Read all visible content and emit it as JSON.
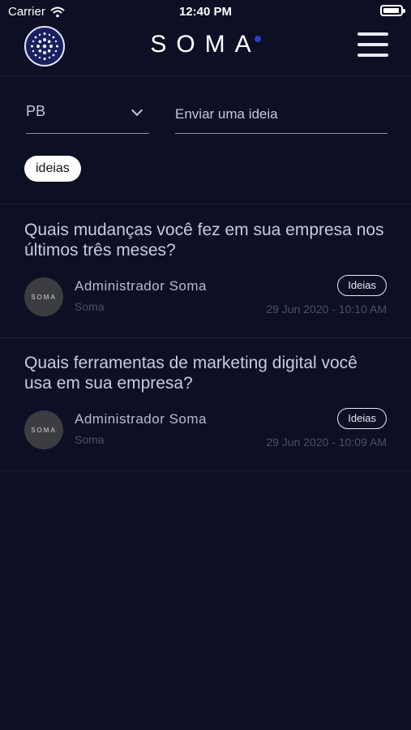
{
  "status_bar": {
    "carrier": "Carrier",
    "time": "12:40 PM",
    "battery_level": 0.95
  },
  "header": {
    "brand": "SOMA"
  },
  "filters": {
    "language_value": "PB",
    "idea_placeholder": "Enviar uma ideia",
    "chip_label": "ideias"
  },
  "posts": [
    {
      "title": "Quais mudanças você fez em sua empresa nos últimos três meses?",
      "avatar_text": "SOMA",
      "author": "Administrador  Soma",
      "organization": "Soma",
      "tag": "Ideias",
      "date": "29 Jun 2020 - 10:10 AM"
    },
    {
      "title": "Quais ferramentas de marketing digital você usa em sua empresa?",
      "avatar_text": "SOMA",
      "author": "Administrador  Soma",
      "organization": "Soma",
      "tag": "Ideias",
      "date": "29 Jun 2020 - 10:09 AM"
    }
  ]
}
